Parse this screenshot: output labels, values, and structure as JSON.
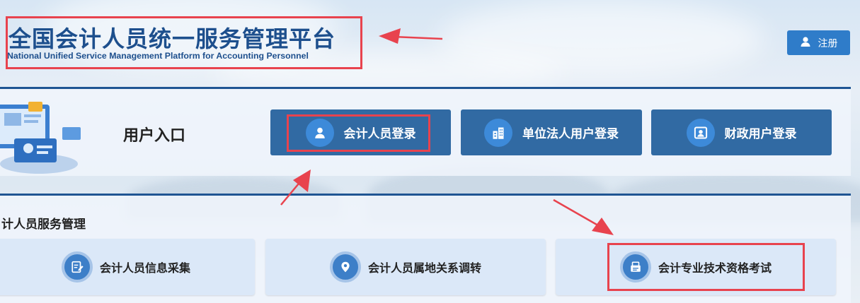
{
  "header": {
    "title": "全国会计人员统一服务管理平台",
    "subtitle": "National Unified Service Management Platform for Accounting Personnel",
    "register": {
      "label": "注册",
      "icon": "user-icon"
    }
  },
  "entry": {
    "title": "用户入口",
    "buttons": [
      {
        "label": "会计人员登录",
        "icon": "person-icon"
      },
      {
        "label": "单位法人用户登录",
        "icon": "building-icon"
      },
      {
        "label": "财政用户登录",
        "icon": "id-card-icon"
      }
    ]
  },
  "services": {
    "title": "计人员服务管理",
    "cards": [
      {
        "label": "会计人员信息采集",
        "icon": "edit-form-icon"
      },
      {
        "label": "会计人员属地关系调转",
        "icon": "location-pin-icon"
      },
      {
        "label": "会计专业技术资格考试",
        "icon": "exam-book-icon"
      }
    ]
  },
  "colors": {
    "brand": "#1d4f8d",
    "button": "#316aa3",
    "register": "#2f7cc9",
    "highlight": "#e8434e",
    "card": "#dbe8f8"
  }
}
